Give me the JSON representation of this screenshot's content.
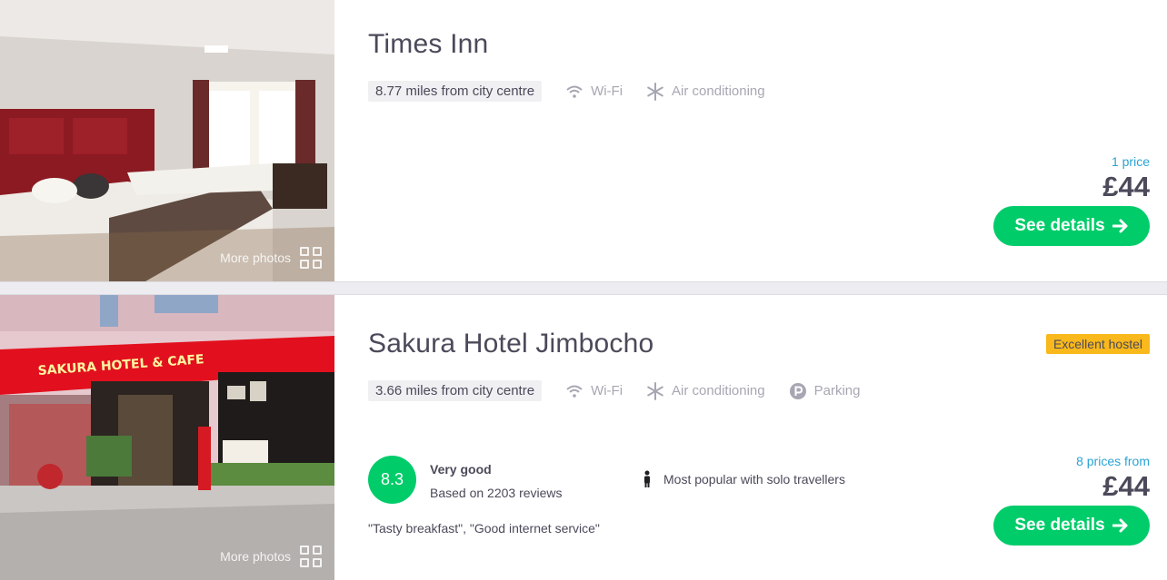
{
  "results": [
    {
      "name": "Times Inn",
      "distance": "8.77 miles from city centre",
      "amenities": [
        {
          "label": "Wi-Fi",
          "icon": "wifi-icon"
        },
        {
          "label": "Air conditioning",
          "icon": "snowflake-icon"
        }
      ],
      "price_count": "1 price",
      "price": "£44",
      "details_label": "See details",
      "more_photos": "More photos"
    },
    {
      "name": "Sakura Hotel Jimbocho",
      "distance": "3.66 miles from city centre",
      "amenities": [
        {
          "label": "Wi-Fi",
          "icon": "wifi-icon"
        },
        {
          "label": "Air conditioning",
          "icon": "snowflake-icon"
        },
        {
          "label": "Parking",
          "icon": "parking-icon"
        }
      ],
      "badge": "Excellent hostel",
      "score": "8.3",
      "rating_label": "Very good",
      "reviews": "Based on 2203 reviews",
      "popular": "Most popular with solo travellers",
      "quotes": "\"Tasty breakfast\", \"Good internet service\"",
      "price_count": "8 prices from",
      "price": "£44",
      "details_label": "See details",
      "more_photos": "More photos",
      "photo_signage": "SAKURA HOTEL & CAFE"
    }
  ],
  "colors": {
    "accent_green": "#00cc6a",
    "price_link_blue": "#2aa3d4",
    "badge_yellow": "#f9b81b",
    "text_dark": "#4a4a5a",
    "text_muted": "#a7a7b3"
  }
}
